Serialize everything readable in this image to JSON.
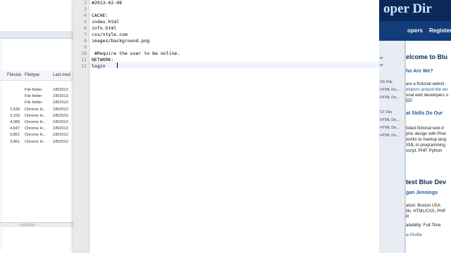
{
  "explorer": {
    "columns": [
      "Filesize",
      "Filetype",
      "Last mod"
    ],
    "rows": [
      {
        "size": "",
        "type": "File folder",
        "date": "2/8/2013"
      },
      {
        "size": "",
        "type": "File folder",
        "date": "2/8/2013"
      },
      {
        "size": "",
        "type": "File folder",
        "date": "2/8/2013"
      },
      {
        "size": "2,639",
        "type": "Chrome H...",
        "date": "2/8/2013"
      },
      {
        "size": "3,103",
        "type": "Chrome H...",
        "date": "2/8/2013"
      },
      {
        "size": "4,089",
        "type": "Chrome H...",
        "date": "2/8/2013"
      },
      {
        "size": "4,647",
        "type": "Chrome H...",
        "date": "2/8/2013"
      },
      {
        "size": "3,851",
        "type": "Chrome H...",
        "date": "2/8/2013"
      },
      {
        "size": "3,861",
        "type": "Chrome H...",
        "date": "2/8/2013"
      }
    ]
  },
  "editor": {
    "lines": [
      {
        "no": "2",
        "text": "#2013-02-08"
      },
      {
        "no": "3",
        "text": ""
      },
      {
        "no": "4",
        "text": "CACHE:"
      },
      {
        "no": "5",
        "text": "index.html"
      },
      {
        "no": "6",
        "text": "info.html"
      },
      {
        "no": "7",
        "text": "css/style.com"
      },
      {
        "no": "8",
        "text": "images/background.png"
      },
      {
        "no": "9",
        "text": ""
      },
      {
        "no": "10",
        "text": " #Require the user to be online."
      },
      {
        "no": "11",
        "text": "NETWORK:"
      },
      {
        "no": "12",
        "text": "login"
      }
    ]
  },
  "browser": {
    "brand": "oper Dir",
    "nav": [
      "opers",
      "Register"
    ],
    "side_items": [
      "er",
      "er",
      "SS File",
      "HTML Do...",
      "HTML Do...",
      "ST File",
      "HTML Do...",
      "HTML Do...",
      "HTML Do..."
    ],
    "page": {
      "welcome": "elcome to Blu",
      "who": "ho Are We?",
      "who_text": [
        "are a fictional websit",
        "elopers around the wo",
        "onal web developers o",
        "EE!"
      ],
      "skills": "at Skills Do Our",
      "skills_text": [
        "listed fictional web d",
        "phic design with Phot",
        "works to markup lang",
        "XML to programming",
        "script, PHP, Python"
      ],
      "latest": "test Blue Dev",
      "name": "gan Jennings",
      "location": "ation: Boston USA",
      "skills_line": "ills: HTML/CSS, PHP",
      "r": "R",
      "availability": "ailability: Full-Time",
      "profile": "w Profile"
    }
  }
}
